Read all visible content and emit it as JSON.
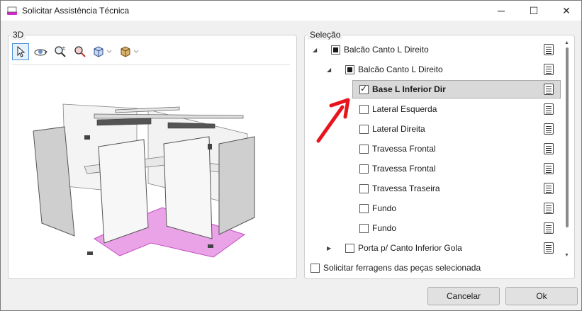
{
  "window": {
    "title": "Solicitar Assistência Técnica",
    "minimize_glyph": "─",
    "maximize_glyph": "☐",
    "close_glyph": "✕"
  },
  "panel_3d": {
    "label": "3D",
    "toolbar": [
      {
        "icon": "cursor-select-icon",
        "active": true
      },
      {
        "icon": "orbit-icon",
        "active": false
      },
      {
        "icon": "zoom-extents-icon",
        "active": false
      },
      {
        "icon": "zoom-icon",
        "active": false
      },
      {
        "icon": "view-cube-icon",
        "active": false,
        "dropdown": true
      },
      {
        "icon": "box-render-icon",
        "active": false,
        "dropdown": true
      }
    ],
    "highlight_color": "#e9a3e6"
  },
  "panel_selection": {
    "label": "Seleção",
    "tree": [
      {
        "label": "Balcão Canto L Direito",
        "level": 0,
        "expander": "◢",
        "state": "indeterminate"
      },
      {
        "label": "Balcão Canto L Direito",
        "level": 1,
        "expander": "◢",
        "state": "indeterminate"
      },
      {
        "label": "Base L Inferior Dir",
        "level": 2,
        "state": "checked",
        "selected": true
      },
      {
        "label": "Lateral Esquerda",
        "level": 2,
        "state": "unchecked"
      },
      {
        "label": "Lateral Direita",
        "level": 2,
        "state": "unchecked"
      },
      {
        "label": "Travessa Frontal",
        "level": 2,
        "state": "unchecked"
      },
      {
        "label": "Travessa Frontal",
        "level": 2,
        "state": "unchecked"
      },
      {
        "label": "Travessa Traseira",
        "level": 2,
        "state": "unchecked"
      },
      {
        "label": "Fundo",
        "level": 2,
        "state": "unchecked"
      },
      {
        "label": "Fundo",
        "level": 2,
        "state": "unchecked"
      },
      {
        "label": "Porta p/ Canto Inferior Gola",
        "level": 1,
        "expander": "▶",
        "state": "unchecked"
      }
    ],
    "annotation_color": "#e8141c"
  },
  "footer": {
    "request_hardware_label": "Solicitar ferragens das peças selecionada",
    "cancel_label": "Cancelar",
    "ok_label": "Ok"
  }
}
